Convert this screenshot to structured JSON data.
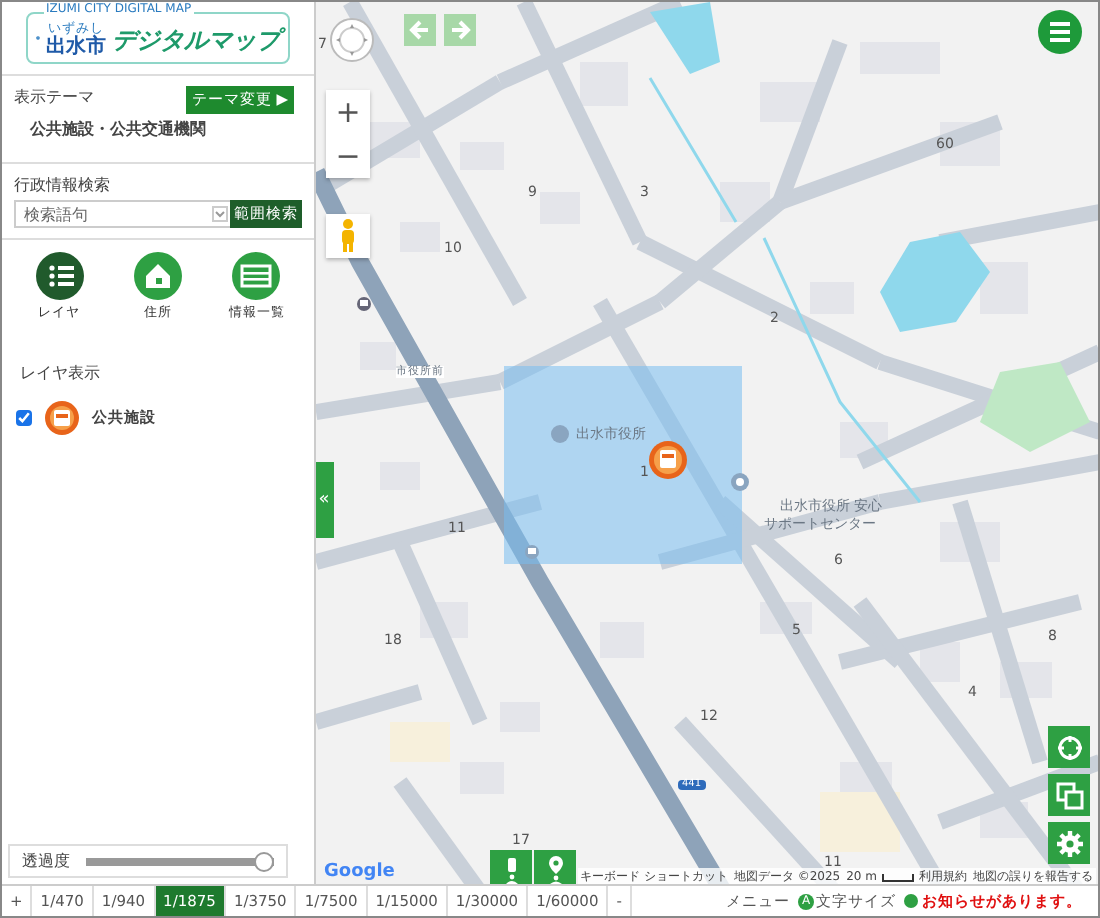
{
  "logo": {
    "caption": "IZUMI CITY DIGITAL MAP",
    "ruby": "いずみし",
    "city": "出水市",
    "title": "デジタルマップ"
  },
  "theme": {
    "label": "表示テーマ",
    "button": "テーマ変更 ▶",
    "current": "公共施設・公共交通機関"
  },
  "search": {
    "label": "行政情報検索",
    "placeholder": "検索語句",
    "button": "範囲検索"
  },
  "tools": [
    {
      "label": "レイヤ",
      "kind": "layers",
      "selected": true
    },
    {
      "label": "住所",
      "kind": "address",
      "selected": false
    },
    {
      "label": "情報一覧",
      "kind": "list",
      "selected": false
    }
  ],
  "layers": {
    "heading": "レイヤ表示",
    "items": [
      {
        "label": "公共施設",
        "checked": true
      }
    ]
  },
  "opacity": {
    "label": "透過度",
    "level": 1.0
  },
  "map": {
    "zoom_in": "+",
    "zoom_out": "−",
    "collapse": "«",
    "labels": [
      {
        "text": "7"
      },
      {
        "text": "9"
      },
      {
        "text": "3"
      },
      {
        "text": "60"
      },
      {
        "text": "10"
      },
      {
        "text": "2"
      },
      {
        "text": "1"
      },
      {
        "text": "11"
      },
      {
        "text": "6"
      },
      {
        "text": "18"
      },
      {
        "text": "5"
      },
      {
        "text": "8"
      },
      {
        "text": "4"
      },
      {
        "text": "12"
      },
      {
        "text": "17"
      },
      {
        "text": "11"
      },
      {
        "text": "441"
      }
    ],
    "places": [
      {
        "text": "市役所前"
      },
      {
        "text": "出水市役所"
      },
      {
        "text": "出水市役所 安心"
      },
      {
        "text": "サポートセンター"
      }
    ],
    "google": "Google",
    "attribution": {
      "shortcuts": "キーボード ショートカット",
      "data": "地図データ ©2025",
      "scale": "20 m",
      "terms": "利用規約",
      "report": "地図の誤りを報告する"
    }
  },
  "scales": {
    "zoom_in": "+",
    "zoom_out": "-",
    "items": [
      {
        "label": "1/470",
        "selected": false
      },
      {
        "label": "1/940",
        "selected": false
      },
      {
        "label": "1/1875",
        "selected": true
      },
      {
        "label": "1/3750",
        "selected": false
      },
      {
        "label": "1/7500",
        "selected": false
      },
      {
        "label": "1/15000",
        "selected": false
      },
      {
        "label": "1/30000",
        "selected": false
      },
      {
        "label": "1/60000",
        "selected": false
      }
    ]
  },
  "footer": {
    "menu": "メニュー",
    "font_badge": "A",
    "font_size": "文字サイズ",
    "notice": "お知らせがあります。"
  }
}
